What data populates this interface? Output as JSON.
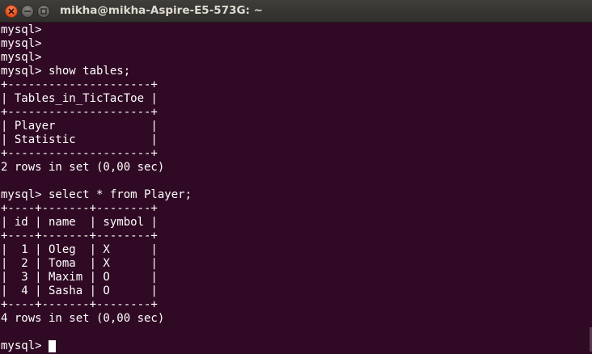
{
  "window": {
    "title": "mikha@mikha-Aspire-E5-573G: ~"
  },
  "icons": {
    "close": "close-icon",
    "minimize": "minimize-icon",
    "maximize": "maximize-icon"
  },
  "colors": {
    "terminal_background": "#300a24",
    "terminal_text": "#ffffff",
    "close_button": "#e65524"
  },
  "terminal": {
    "lines": [
      "mysql>",
      "mysql>",
      "mysql>",
      "mysql> show tables;",
      "+---------------------+",
      "| Tables_in_TicTacToe |",
      "+---------------------+",
      "| Player              |",
      "| Statistic           |",
      "+---------------------+",
      "2 rows in set (0,00 sec)",
      "",
      "mysql> select * from Player;",
      "+----+-------+--------+",
      "| id | name  | symbol |",
      "+----+-------+--------+",
      "|  1 | Oleg  | X      |",
      "|  2 | Toma  | X      |",
      "|  3 | Maxim | O      |",
      "|  4 | Sasha | O      |",
      "+----+-------+--------+",
      "4 rows in set (0,00 sec)",
      "",
      "mysql> "
    ]
  }
}
